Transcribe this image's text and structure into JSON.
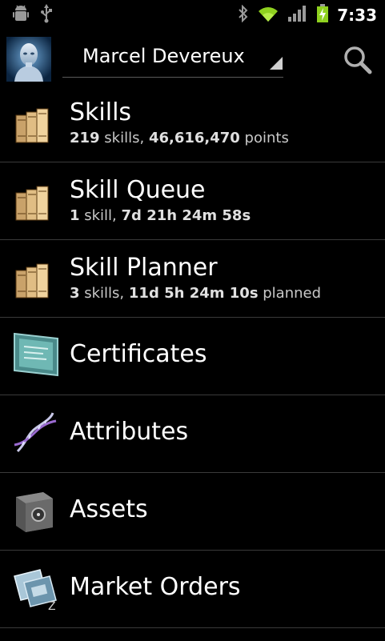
{
  "status_bar": {
    "time": "7:33",
    "icons": [
      "android-debug-icon",
      "usb-icon",
      "bluetooth-icon",
      "wifi-icon",
      "signal-icon",
      "battery-charging-icon"
    ]
  },
  "header": {
    "character_name": "Marcel Devereux",
    "avatar": "character-portrait",
    "search_icon": "search-icon"
  },
  "menu": {
    "skills": {
      "title": "Skills",
      "count": "219",
      "count_label": " skills, ",
      "points": "46,616,470",
      "points_label": " points",
      "icon": "books-icon"
    },
    "skill_queue": {
      "title": "Skill Queue",
      "count": "1",
      "count_label": " skill, ",
      "time": "7d 21h 24m 58s",
      "icon": "books-icon"
    },
    "skill_planner": {
      "title": "Skill Planner",
      "count": "3",
      "count_label": " skills, ",
      "time": "11d 5h 24m 10s",
      "time_label": " planned",
      "icon": "books-icon"
    },
    "certificates": {
      "title": "Certificates",
      "icon": "certificate-icon"
    },
    "attributes": {
      "title": "Attributes",
      "icon": "dna-icon"
    },
    "assets": {
      "title": "Assets",
      "icon": "safe-icon"
    },
    "market_orders": {
      "title": "Market Orders",
      "icon": "market-orders-icon"
    }
  }
}
